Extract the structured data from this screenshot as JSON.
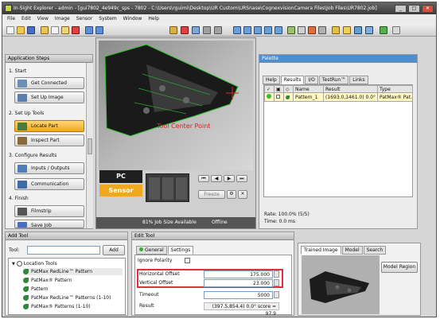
{
  "window": {
    "title": "In-Sight Explorer - admin - [gui7802_4e949c_sps - 7802 - C:\\Users\\rguimi\\Desktop\\UR Custom\\URSnase\\CognexvisionCamera Files\\Job Files\\UR7802.job]"
  },
  "menu": [
    "File",
    "Edit",
    "View",
    "Image",
    "Sensor",
    "System",
    "Window",
    "Help"
  ],
  "steps_panel": {
    "header": "Application Steps",
    "sections": [
      {
        "title": "1. Start",
        "items": [
          "Get Connected",
          "Set Up Image"
        ]
      },
      {
        "title": "2. Set Up Tools",
        "items": [
          "Locate Part",
          "Inspect Part"
        ]
      },
      {
        "title": "3. Configure Results",
        "items": [
          "Inputs / Outputs",
          "Communication"
        ]
      },
      {
        "title": "4. Finish",
        "items": [
          "Filmstrip",
          "Save Job"
        ]
      }
    ],
    "active_item": "Locate Part"
  },
  "image_view": {
    "annotation": "Tool Center Point",
    "pc_label": "PC",
    "sensor_label": "Sensor",
    "freeze_label": "Freeze",
    "status_job_size": "81% Job Size Available",
    "status_mode": "Offline"
  },
  "palette": {
    "header": "Palette",
    "tabs": [
      "Help",
      "Results",
      "I/O",
      "TestRun™",
      "Links"
    ],
    "active_tab": "Results",
    "columns": [
      "Name",
      "Result",
      "Type"
    ],
    "rows": [
      {
        "name": "Pattern_1",
        "result": "(1693.0,1461.0) 0.0° s...",
        "type": "PatMax® Pat..."
      }
    ],
    "rate": "Rate: 100.0% (5/5)",
    "time": "Time: 0.0 ms"
  },
  "add_tool": {
    "header": "Add Tool",
    "tool_label": "Tool:",
    "add_button": "Add",
    "category": "Location Tools",
    "items": [
      "PatMax RedLine™ Pattern",
      "PatMax® Pattern",
      "Pattern",
      "PatMax RedLine™ Patterns (1-10)",
      "PatMax® Patterns (1-10)"
    ],
    "selected_item": "PatMax RedLine™ Pattern"
  },
  "edit_tool": {
    "header": "Edit Tool",
    "tabs": [
      "General",
      "Settings"
    ],
    "active_tab": "Settings",
    "ignore_polarity_label": "Ignore Polarity",
    "ignore_polarity_checked": false,
    "fields": [
      {
        "label": "Horizontal Offset",
        "value": "175.000"
      },
      {
        "label": "Vertical Offset",
        "value": "23.000"
      },
      {
        "label": "Timeout",
        "value": "5000"
      }
    ],
    "result_label": "Result",
    "result_value": "(397.5,854.4) 0.0° score = 97.9"
  },
  "trained_panel": {
    "tabs": [
      "Trained Image",
      "Model",
      "Search"
    ],
    "active_tab": "Trained Image",
    "model_region_button": "Model Region"
  },
  "colors": {
    "highlight_box": "#e0303a",
    "active_step": "#f5b431",
    "annotation": "#e02020"
  }
}
